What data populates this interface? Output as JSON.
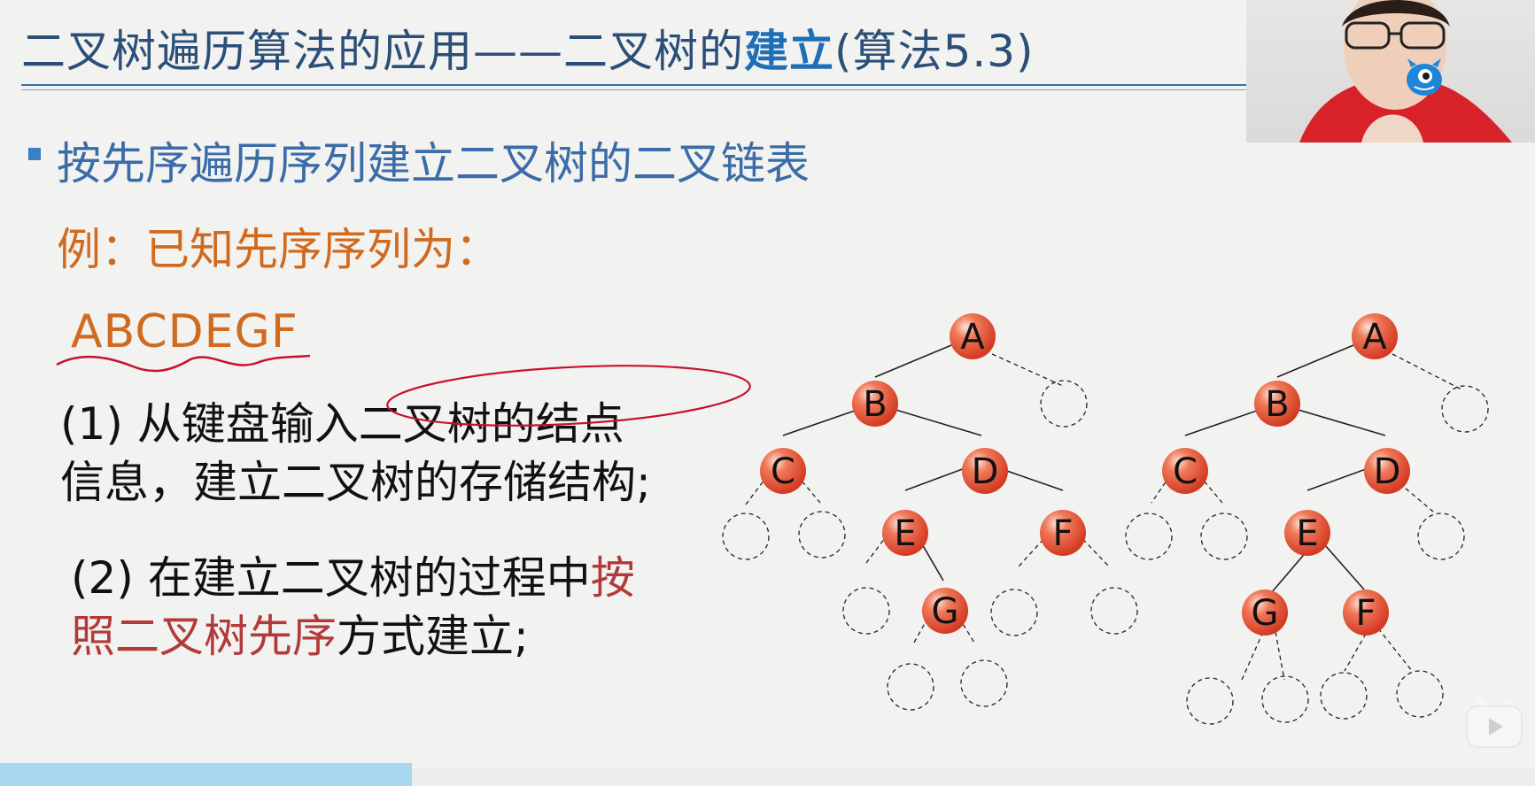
{
  "slide": {
    "title_prefix": "二叉树遍历算法的应用——二叉树的",
    "title_highlight": "建立",
    "title_suffix": "(算法5.3)",
    "bullet": "按先序遍历序列建立二叉树的二叉链表",
    "example_label": "例：已知先序序列为：",
    "sequence": "ABCDEGF",
    "step1_line1": "(1) 从键盘输入二叉树的结点",
    "step1_line2": "信息，建立二叉树的存储结构;",
    "step2_line1_a": "(2) 在建立二叉树的过程中",
    "step2_line1_b": "按",
    "step2_line2_a": "照二叉树先序",
    "step2_line2_b": "方式建立;"
  },
  "trees": {
    "tree1_nodes": [
      "A",
      "B",
      "C",
      "D",
      "E",
      "F",
      "G"
    ],
    "tree2_nodes": [
      "A",
      "B",
      "C",
      "D",
      "E",
      "G",
      "F"
    ]
  },
  "colors": {
    "title": "#2b4f78",
    "highlight": "#1f6fb5",
    "bullet": "#3b6ca8",
    "example": "#d06a1e",
    "emphasis": "#b23a3a",
    "node_fill": "#e8533a",
    "annotation": "#c8102e"
  },
  "icons": {
    "mascot": "blue-mascot-icon",
    "play": "play-icon"
  }
}
